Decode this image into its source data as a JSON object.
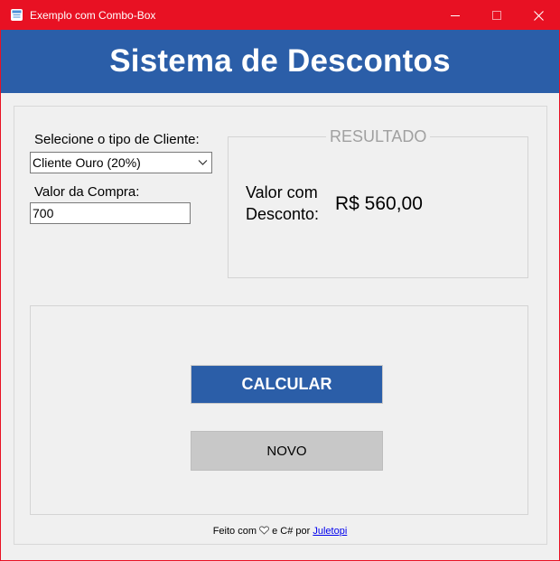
{
  "window": {
    "title": "Exemplo com Combo-Box",
    "accent_color": "#e81123"
  },
  "header": {
    "title": "Sistema de Descontos",
    "background_color": "#2b5ea8"
  },
  "form": {
    "tipo_label": "Selecione o tipo de Cliente:",
    "tipo_selected": "Cliente Ouro (20%)",
    "valor_label": "Valor da Compra:",
    "valor_value": "700"
  },
  "resultado": {
    "legend": "RESULTADO",
    "label": "Valor com Desconto:",
    "value": "R$ 560,00"
  },
  "buttons": {
    "calcular": "CALCULAR",
    "novo": "NOVO"
  },
  "footer": {
    "prefix": "Feito com",
    "middle": "e C# por",
    "author_link": "Juletopi",
    "heart_icon": "heart-icon"
  }
}
